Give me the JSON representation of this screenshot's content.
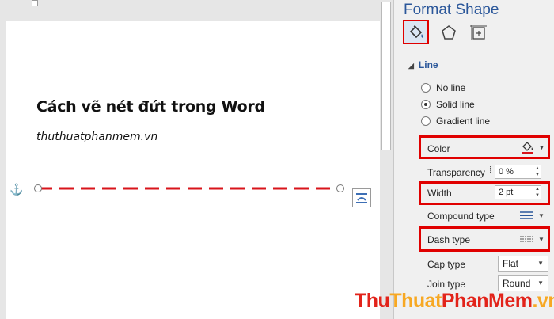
{
  "document": {
    "title": "Cách vẽ nét đứt trong Word",
    "subtitle": "thuthuatphanmem.vn"
  },
  "panel": {
    "title": "Format Shape",
    "tabs": [
      "fill-line-icon",
      "effects-icon",
      "layout-properties-icon"
    ],
    "section": "Line",
    "line_options": [
      {
        "label": "No line",
        "checked": false
      },
      {
        "label": "Solid line",
        "checked": true
      },
      {
        "label": "Gradient line",
        "checked": false
      }
    ],
    "color_label": "Color",
    "transparency_label": "Transparency",
    "transparency_value": "0 %",
    "width_label": "Width",
    "width_value": "2 pt",
    "compound_label": "Compound type",
    "dash_label": "Dash type",
    "cap_label": "Cap type",
    "cap_value": "Flat",
    "join_label": "Join type",
    "join_value": "Round"
  },
  "colors": {
    "accent": "#2b579a",
    "highlight": "#e00000",
    "line_color": "#d8141b"
  },
  "watermark": {
    "part1": "Thu",
    "part2": "Thuat",
    "part3": "PhanMem",
    "part4": ".vn"
  }
}
